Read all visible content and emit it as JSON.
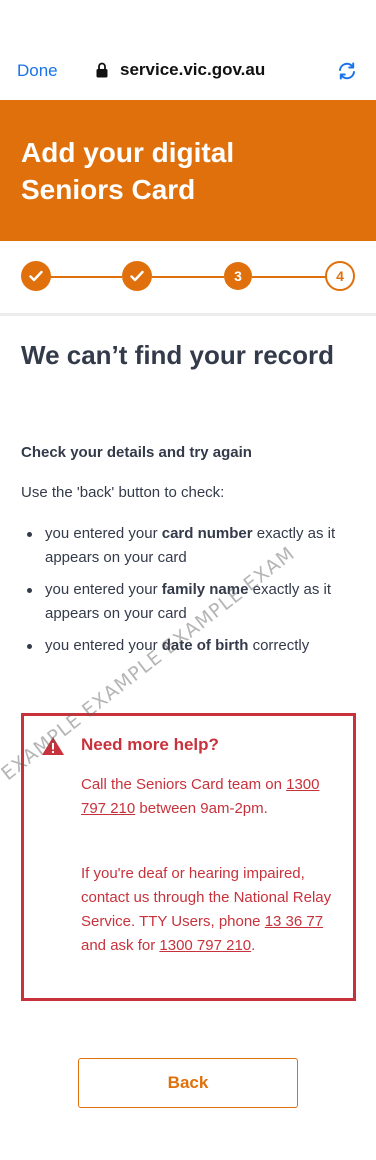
{
  "browser": {
    "done_label": "Done",
    "url": "service.vic.gov.au",
    "lock_icon": "lock-icon",
    "reload_icon": "reload-icon"
  },
  "header": {
    "title": "Add your digital Seniors Card",
    "color": "#e0700c"
  },
  "progress": {
    "steps": [
      {
        "state": "complete",
        "label": ""
      },
      {
        "state": "complete",
        "label": ""
      },
      {
        "state": "current",
        "label": "3"
      },
      {
        "state": "upcoming",
        "label": "4"
      }
    ]
  },
  "main": {
    "title": "We can’t find your record",
    "subhead": "Check your details and try again",
    "intro": "Use the 'back' button to check:",
    "items": [
      {
        "before": "you entered your ",
        "bold": "card number",
        "after": " exactly as it appears on your card"
      },
      {
        "before": "you entered your ",
        "bold": "family name",
        "after": " exactly as it appears on your card"
      },
      {
        "before": "you entered your ",
        "bold": "date of birth",
        "after": " correctly"
      }
    ]
  },
  "help": {
    "title": "Need more help?",
    "icon": "warning-icon",
    "p1_before": "Call the Seniors Card team on ",
    "p1_link": "1300 797 210",
    "p1_after": " between 9am-2pm.",
    "p2_before": "If you're deaf or hearing impaired, contact us through the National Relay Service. TTY Users, phone ",
    "p2_link1": "13 36 77",
    "p2_mid": " and ask for ",
    "p2_link2": "1300 797 210",
    "p2_after": ".",
    "accent": "#c8323c"
  },
  "back_label": "Back",
  "watermark": "MPLE  EXAMPLE  EXAMPLE  EXAMPLE  EXAMPLE  EXAM"
}
